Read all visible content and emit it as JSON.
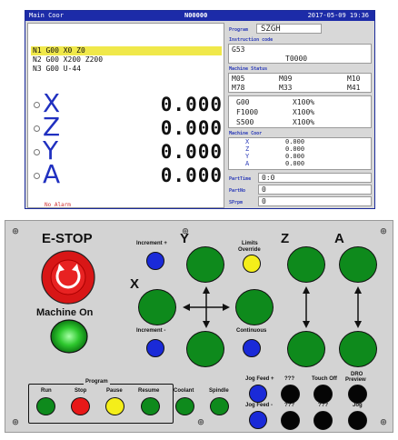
{
  "screen": {
    "title_left": "Main Coor",
    "title_center": "N00000",
    "title_right": "2017-05-09 19:36",
    "gcode_lines": [
      "N1 G00 X0 Z0",
      "N2 G00 X200 Z200",
      "N3 G00 U-44"
    ],
    "active_line": 0,
    "axes": [
      {
        "letter": "X",
        "value": "0.000"
      },
      {
        "letter": "Z",
        "value": "0.000"
      },
      {
        "letter": "Y",
        "value": "0.000"
      },
      {
        "letter": "A",
        "value": "0.000"
      }
    ],
    "alarm": "No Alarm",
    "program_label": "Program",
    "program_name": "SZGH",
    "instruction_label": "Instruction code",
    "instruction_code": "G53",
    "tool_code": "T0000",
    "machine_status_label": "Machine Status",
    "status_codes": [
      [
        "M05",
        "M09",
        "M10"
      ],
      [
        "M78",
        "M33",
        "M41"
      ]
    ],
    "mode": "G00",
    "mode_override": "X100%",
    "feed": "F1000",
    "feed_override": "X100%",
    "spindle": "S500",
    "spindle_override": "X100%",
    "machine_coor_label": "Machine Coor",
    "machine_coor": [
      {
        "axis": "X",
        "value": "0.000"
      },
      {
        "axis": "Z",
        "value": "0.000"
      },
      {
        "axis": "Y",
        "value": "0.000"
      },
      {
        "axis": "A",
        "value": "0.000"
      }
    ],
    "part_time_label": "PartTime",
    "part_time": "0:0",
    "part_no_label": "PartNo",
    "part_no": "0",
    "srpm_label": "SPrpm",
    "srpm": "0"
  },
  "panel": {
    "estop": "E-STOP",
    "machine_on": "Machine On",
    "increment_plus": "Increment +",
    "increment_minus": "Increment -",
    "y_axis": "Y",
    "x_axis": "X",
    "z_axis": "Z",
    "a_axis": "A",
    "limits_override_1": "Limits",
    "limits_override_2": "Override",
    "continuous": "Continuous",
    "program": "Program",
    "run": "Run",
    "stop": "Stop",
    "pause": "Pause",
    "resume": "Resume",
    "coolant": "Coolant",
    "spindle": "Spindle",
    "jog_feed_plus": "Jog Feed +",
    "jog_feed_minus": "Jog Feed -",
    "q1": "???",
    "q2": "???",
    "q3": "???",
    "touch_off": "Touch Off",
    "dro_preview_1": "DRO",
    "dro_preview_2": "Preview",
    "jog": "Jog"
  },
  "colors": {
    "accent_blue": "#1c2ba8",
    "axis_blue": "#2030c0",
    "highlight": "#f0e84a",
    "green_button": "#0e8a1c",
    "blue_button": "#1a2ad8",
    "red_button": "#e81818",
    "yellow_button": "#f4ee1a"
  }
}
